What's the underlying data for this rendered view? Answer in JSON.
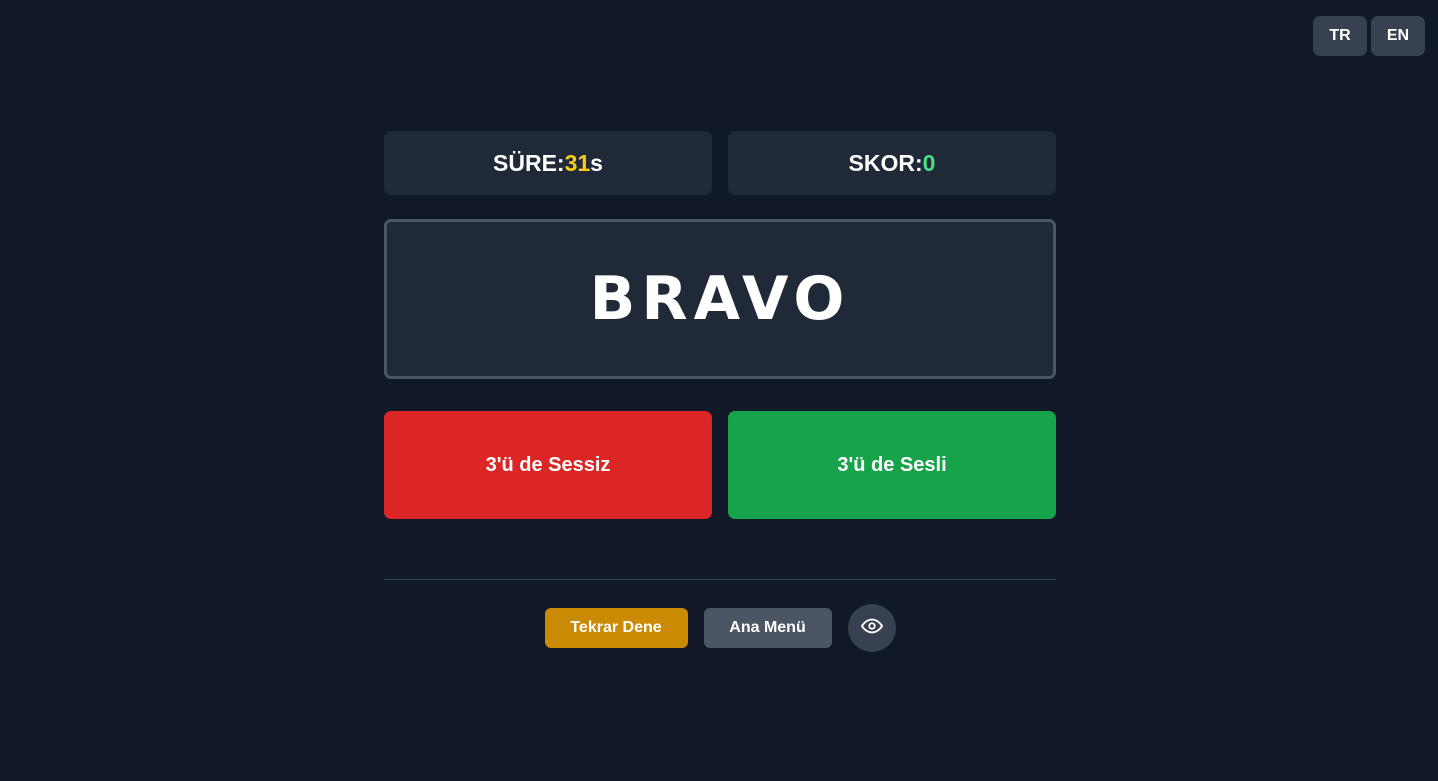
{
  "language": {
    "options": [
      "TR",
      "EN"
    ]
  },
  "stats": {
    "time_label": "SÜRE: ",
    "time_value": "31",
    "time_unit": "s",
    "score_label": "SKOR: ",
    "score_value": "0"
  },
  "word": "BRAVO",
  "answers": {
    "voiceless_label": "3'ü de Sessiz",
    "voiced_label": "3'ü de Sesli"
  },
  "controls": {
    "retry_label": "Tekrar Dene",
    "menu_label": "Ana Menü",
    "reveal_icon": "eye-icon"
  },
  "colors": {
    "background": "#111827",
    "panel": "#1f2937",
    "time_accent": "#facc15",
    "score_accent": "#4ade80",
    "voiceless": "#dc2626",
    "voiced": "#16a34a",
    "retry": "#ca8a04",
    "menu": "#4b5563"
  }
}
